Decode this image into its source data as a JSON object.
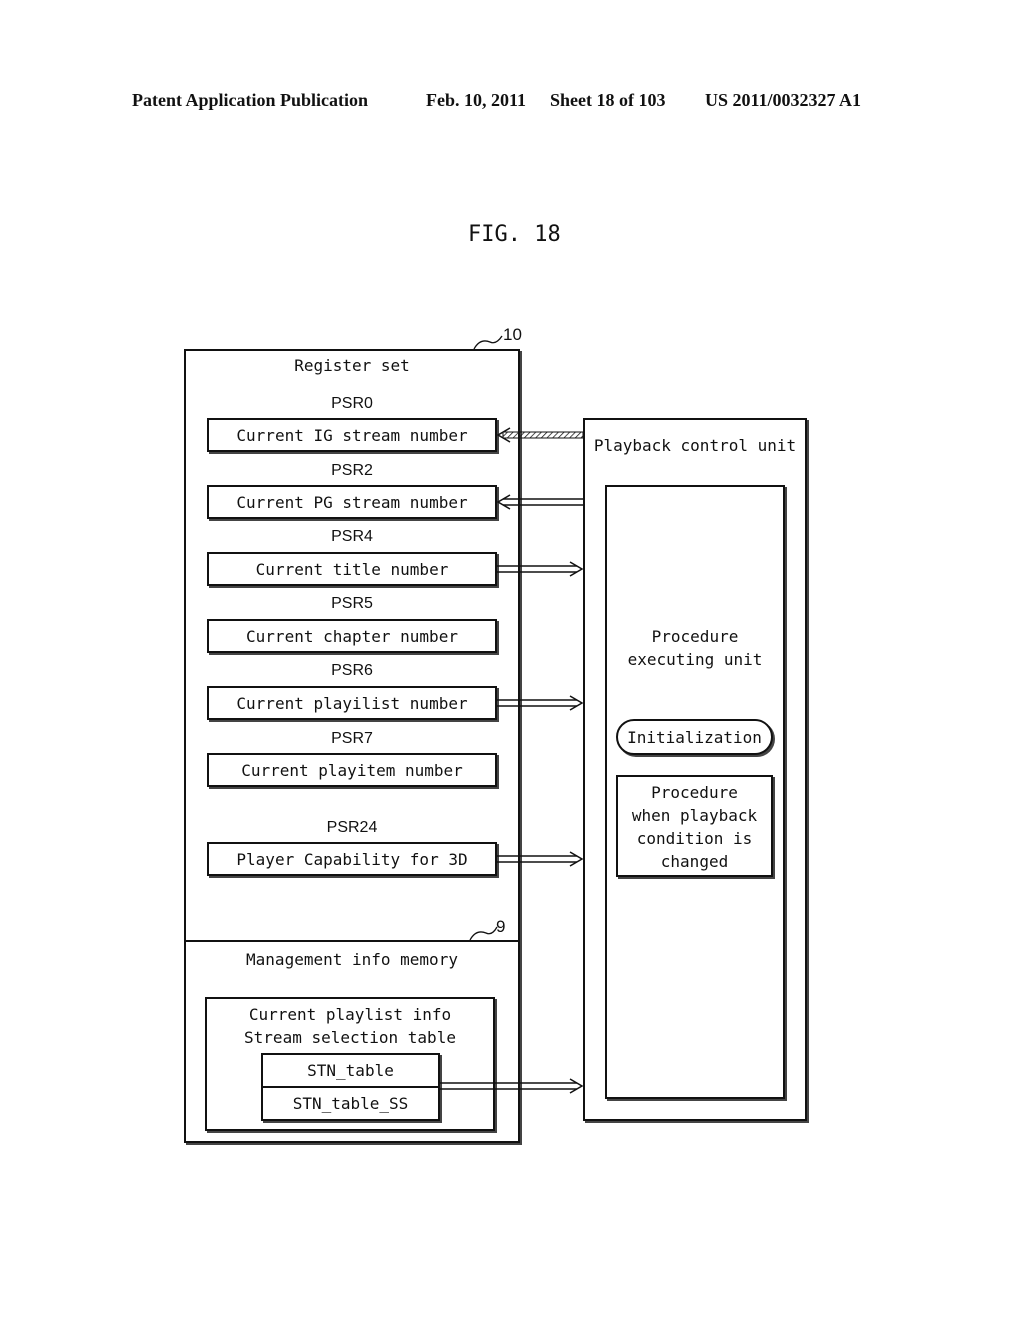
{
  "header": {
    "publication": "Patent Application Publication",
    "date": "Feb. 10, 2011",
    "sheet": "Sheet 18 of 103",
    "number": "US 2011/0032327 A1"
  },
  "figure": {
    "title": "FIG. 18"
  },
  "register_set": {
    "ref": "10",
    "title": "Register set",
    "registers": [
      {
        "psr": "PSR0",
        "label": "Current IG stream number",
        "arrow": "in-hatched"
      },
      {
        "psr": "PSR2",
        "label": "Current PG stream number",
        "arrow": "in"
      },
      {
        "psr": "PSR4",
        "label": "Current title number",
        "arrow": "out"
      },
      {
        "psr": "PSR5",
        "label": "Current chapter number",
        "arrow": "none"
      },
      {
        "psr": "PSR6",
        "label": "Current playilist number",
        "arrow": "out"
      },
      {
        "psr": "PSR7",
        "label": "Current playitem number",
        "arrow": "none"
      },
      {
        "psr": "PSR24",
        "label": "Player Capability for 3D",
        "arrow": "out"
      }
    ]
  },
  "management_info_memory": {
    "ref": "9",
    "title": "Management info memory",
    "playlist_info_line1": "Current playlist info",
    "playlist_info_line2": "Stream selection table",
    "tables": [
      "STN_table",
      "STN_table_SS"
    ]
  },
  "playback_control_unit": {
    "title": "Playback control unit",
    "procedure_unit": {
      "title_line1": "Procedure",
      "title_line2": "executing unit",
      "initialization": "Initialization",
      "change_procedure": [
        "Procedure",
        "when playback",
        "condition is",
        "changed"
      ]
    }
  }
}
